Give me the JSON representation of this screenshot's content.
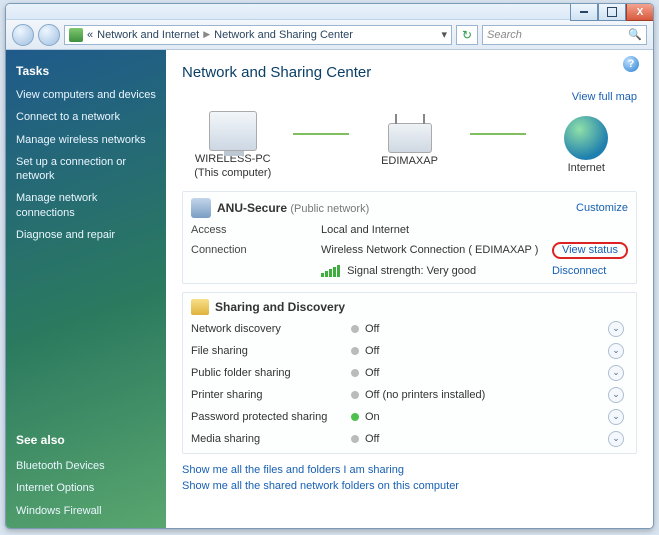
{
  "header": {
    "breadcrumb_prefix": "«",
    "breadcrumb1": "Network and Internet",
    "breadcrumb2": "Network and Sharing Center",
    "search_placeholder": "Search"
  },
  "sidebar": {
    "tasks_header": "Tasks",
    "items": [
      "View computers and devices",
      "Connect to a network",
      "Manage wireless networks",
      "Set up a connection or network",
      "Manage network connections",
      "Diagnose and repair"
    ],
    "seealso_header": "See also",
    "seealso": [
      "Bluetooth Devices",
      "Internet Options",
      "Windows Firewall"
    ]
  },
  "main": {
    "title": "Network and Sharing Center",
    "view_full_map": "View full map",
    "map": {
      "computer": "WIRELESS-PC",
      "computer_sub": "(This computer)",
      "ap": "EDIMAXAP",
      "internet": "Internet"
    },
    "network": {
      "name": "ANU-Secure",
      "category": "(Public network)",
      "customize": "Customize",
      "access_label": "Access",
      "access_value": "Local and Internet",
      "connection_label": "Connection",
      "connection_value": "Wireless Network Connection ( EDIMAXAP )",
      "view_status": "View status",
      "signal_label": "Signal strength:",
      "signal_value": " Very good",
      "disconnect": "Disconnect"
    },
    "sharing": {
      "header": "Sharing and Discovery",
      "rows": [
        {
          "label": "Network discovery",
          "value": "Off",
          "on": false
        },
        {
          "label": "File sharing",
          "value": "Off",
          "on": false
        },
        {
          "label": "Public folder sharing",
          "value": "Off",
          "on": false
        },
        {
          "label": "Printer sharing",
          "value": "Off (no printers installed)",
          "on": false
        },
        {
          "label": "Password protected sharing",
          "value": "On",
          "on": true
        },
        {
          "label": "Media sharing",
          "value": "Off",
          "on": false
        }
      ]
    },
    "footer_links": [
      "Show me all the files and folders I am sharing",
      "Show me all the shared network folders on this computer"
    ]
  }
}
